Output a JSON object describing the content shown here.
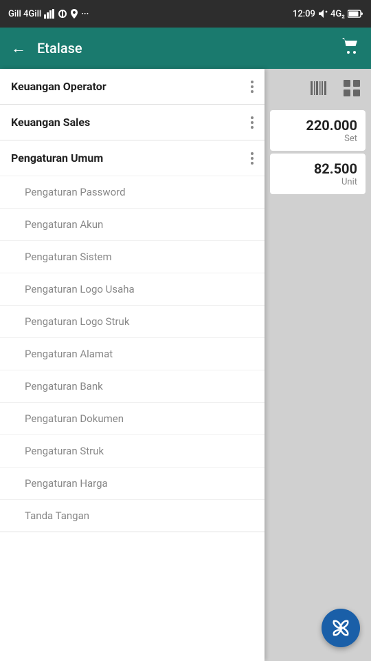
{
  "statusBar": {
    "carrier": "Gill 4Gill",
    "time": "12:09",
    "batteryIcon": "battery-icon"
  },
  "header": {
    "backLabel": "←",
    "title": "Etalase",
    "cartIcon": "cart-icon"
  },
  "sidebar": {
    "sections": [
      {
        "id": "keuangan-operator",
        "label": "Keuangan Operator",
        "hasMenu": true,
        "subItems": []
      },
      {
        "id": "keuangan-sales",
        "label": "Keuangan Sales",
        "hasMenu": true,
        "subItems": []
      },
      {
        "id": "pengaturan-umum",
        "label": "Pengaturan Umum",
        "hasMenu": true,
        "subItems": [
          "Pengaturan Password",
          "Pengaturan Akun",
          "Pengaturan Sistem",
          "Pengaturan Logo Usaha",
          "Pengaturan Logo Struk",
          "Pengaturan Alamat",
          "Pengaturan Bank",
          "Pengaturan Dokumen",
          "Pengaturan Struk",
          "Pengaturan Harga",
          "Tanda Tangan"
        ]
      }
    ]
  },
  "rightPanel": {
    "products": [
      {
        "price": "220.000",
        "unit": "Set"
      },
      {
        "price": "82.500",
        "unit": "Unit"
      }
    ]
  }
}
